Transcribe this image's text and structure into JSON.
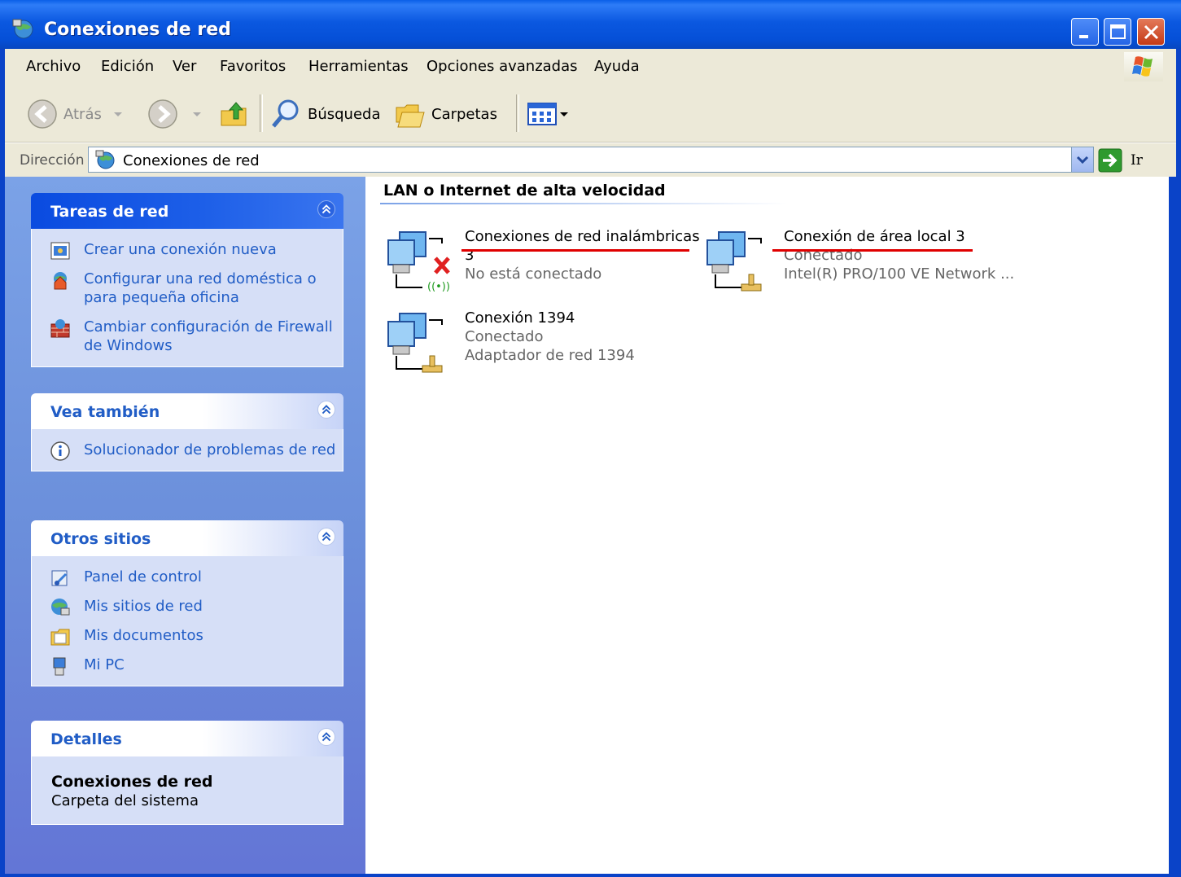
{
  "window": {
    "title": "Conexiones de red"
  },
  "menu": [
    "Archivo",
    "Edición",
    "Ver",
    "Favoritos",
    "Herramientas",
    "Opciones avanzadas",
    "Ayuda"
  ],
  "toolbar": {
    "back": "Atrás",
    "search": "Búsqueda",
    "folders": "Carpetas"
  },
  "address": {
    "label": "Dirección",
    "value": "Conexiones de red",
    "go": "Ir"
  },
  "taskpane": {
    "network_tasks": {
      "title": "Tareas de red",
      "links": [
        "Crear una conexión nueva",
        "Configurar una red doméstica o para pequeña oficina",
        "Cambiar configuración de Firewall de Windows"
      ]
    },
    "see_also": {
      "title": "Vea también",
      "links": [
        "Solucionador de problemas de red"
      ]
    },
    "other_places": {
      "title": "Otros sitios",
      "links": [
        "Panel de control",
        "Mis sitios de red",
        "Mis documentos",
        "Mi PC"
      ]
    },
    "details": {
      "title": "Detalles",
      "name": "Conexiones de red",
      "type": "Carpeta del sistema"
    }
  },
  "content": {
    "group_title": "LAN o Internet de alta velocidad",
    "connections": [
      {
        "name_line1": "Conexiones de red inalámbricas",
        "name_line2": "3",
        "status": "No está conectado",
        "device": ""
      },
      {
        "name_line1": "Conexión de área local 3",
        "name_line2": "",
        "status": "Conectado",
        "device": "Intel(R) PRO/100 VE Network ..."
      },
      {
        "name_line1": "Conexión 1394",
        "name_line2": "",
        "status": "Conectado",
        "device": "Adaptador de red 1394"
      }
    ]
  },
  "colors": {
    "xp_blue": "#0a43c8",
    "link_blue": "#215dc6",
    "annotation_red": "#e00000"
  }
}
